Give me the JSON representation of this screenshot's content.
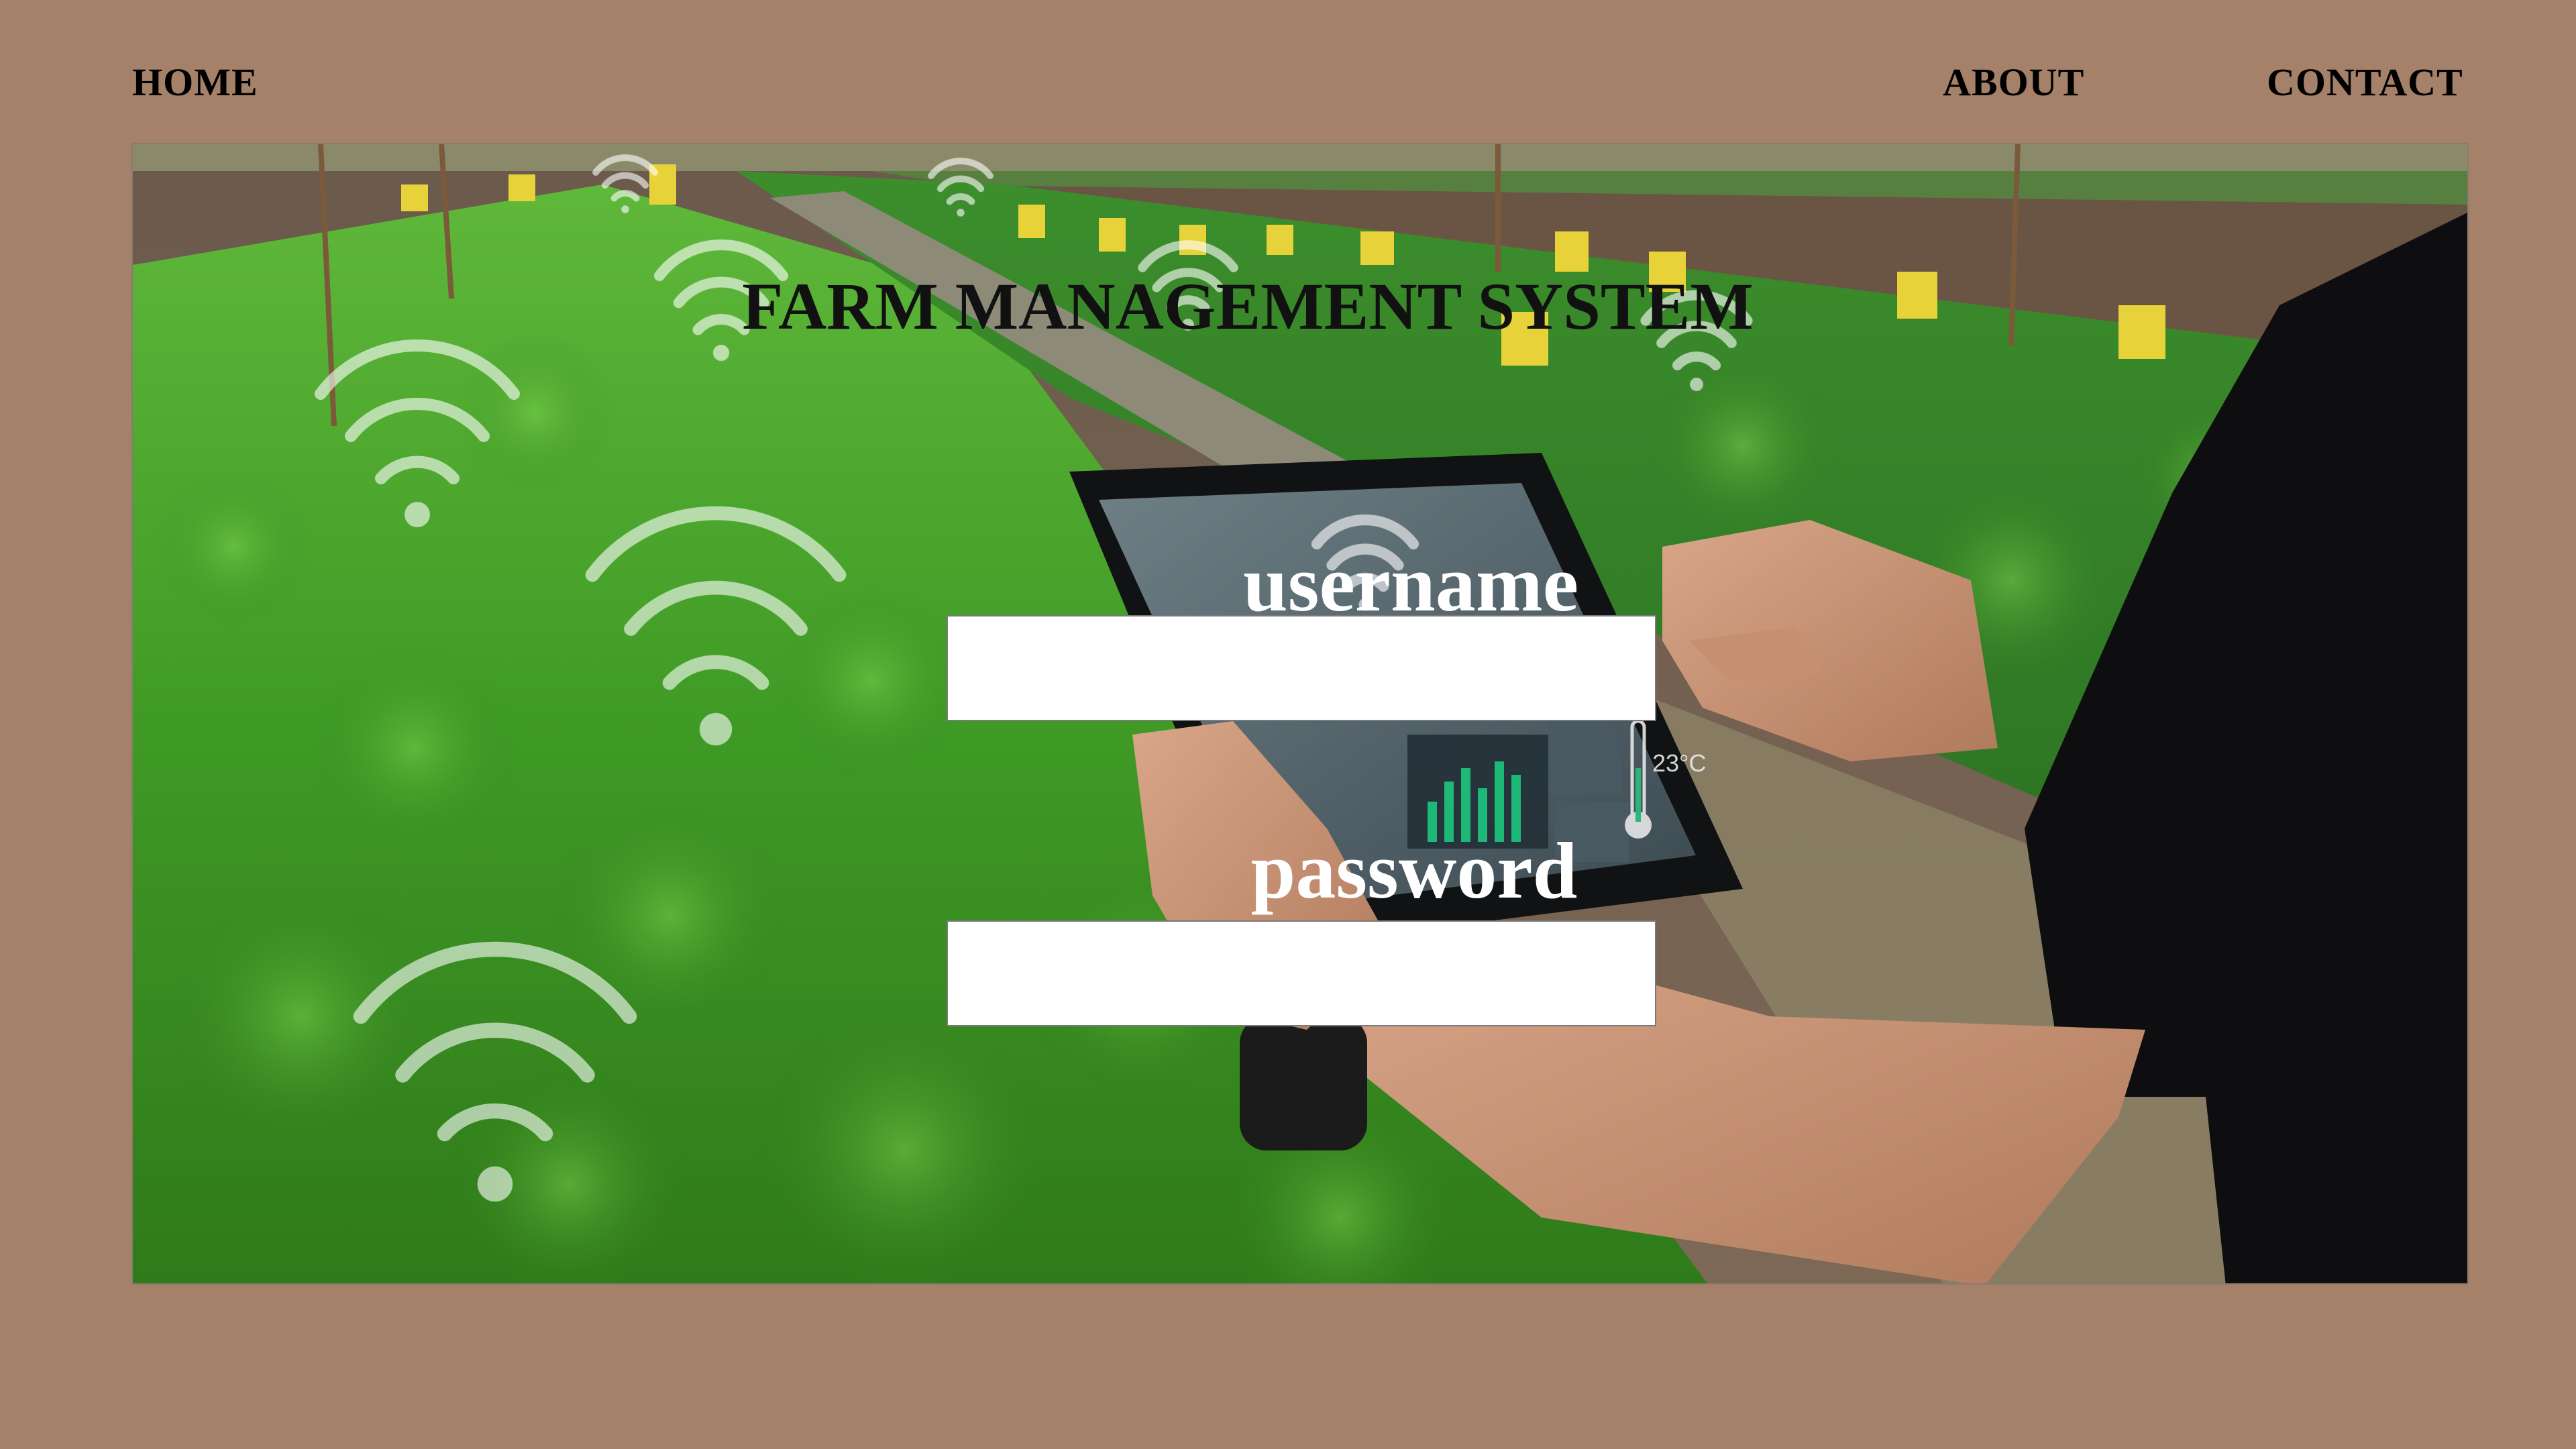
{
  "nav": {
    "home_label": "HOME",
    "about_label": "ABOUT",
    "contact_label": "CONTACT"
  },
  "hero": {
    "title": "FARM MANAGEMENT SYSTEM",
    "tablet_reading": "23°C"
  },
  "login": {
    "username_label": "username",
    "username_value": "",
    "password_label": "password",
    "password_value": ""
  },
  "colors": {
    "page_background": "#a58169",
    "nav_text": "#000000",
    "title_text": "#111111",
    "label_text": "#ffffff",
    "input_background": "#ffffff"
  },
  "icons": [
    "wifi-icon",
    "thermometer-icon",
    "bar-chart-icon"
  ]
}
